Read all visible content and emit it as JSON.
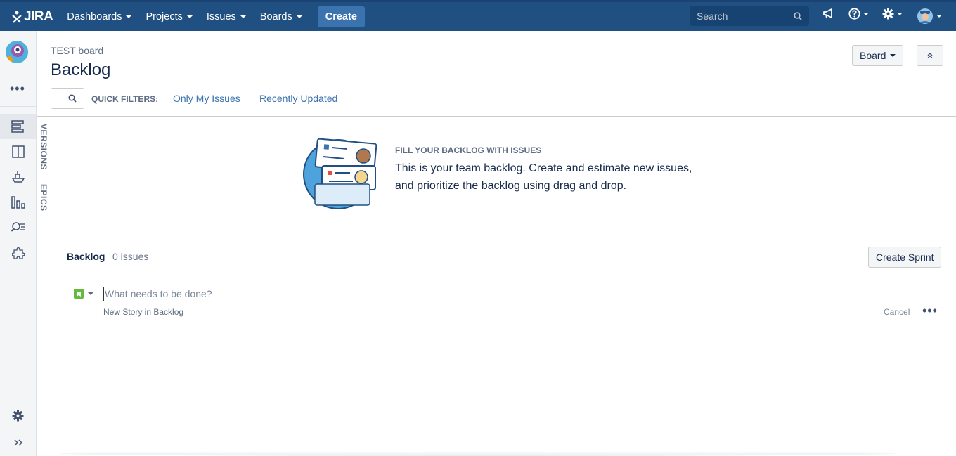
{
  "topbar": {
    "logo": "JIRA",
    "nav": [
      "Dashboards",
      "Projects",
      "Issues",
      "Boards"
    ],
    "create_label": "Create",
    "search_placeholder": "Search"
  },
  "header": {
    "breadcrumb": "TEST board",
    "title": "Backlog",
    "board_button": "Board"
  },
  "quick_filters": {
    "label": "QUICK FILTERS:",
    "items": [
      "Only My Issues",
      "Recently Updated"
    ]
  },
  "strip": {
    "versions": "VERSIONS",
    "epics": "EPICS"
  },
  "empty_state": {
    "heading": "FILL YOUR BACKLOG WITH ISSUES",
    "line1": "This is your team backlog. Create and estimate new issues,",
    "line2": "and prioritize the backlog using drag and drop."
  },
  "backlog": {
    "title": "Backlog",
    "count": "0 issues",
    "create_sprint": "Create Sprint",
    "input_placeholder": "What needs to be done?",
    "hint": "New Story in Backlog",
    "cancel": "Cancel"
  },
  "colors": {
    "header_bg": "#205081",
    "create_btn": "#3b73af",
    "link": "#3b73af",
    "story_green": "#63ba3c"
  }
}
